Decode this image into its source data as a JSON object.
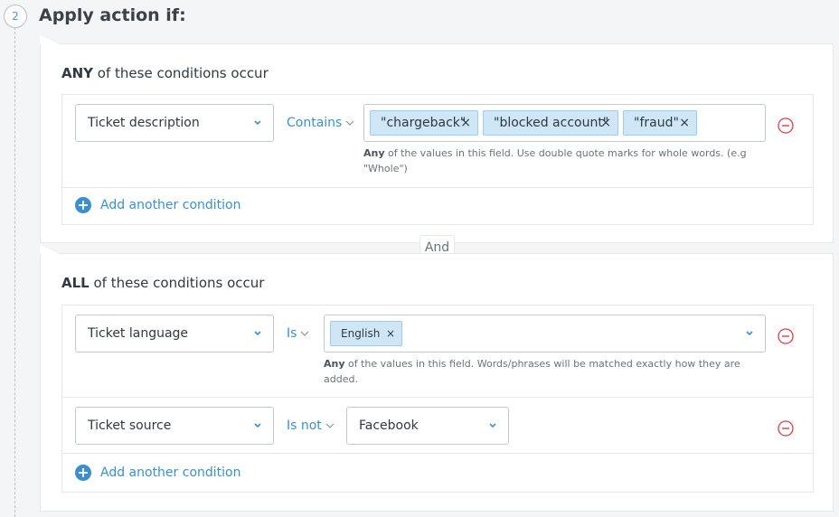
{
  "step": {
    "number": "2",
    "title": "Apply action if:"
  },
  "any_group": {
    "quantifier": "ANY",
    "heading_rest": " of these conditions occur",
    "conditions": [
      {
        "field": "Ticket description",
        "operator": "Contains",
        "tags": [
          "\"chargeback\"",
          "\"blocked account\"",
          "\"fraud\""
        ],
        "hint_bold": "Any",
        "hint_rest": " of the values in this field. Use double quote marks for whole words. (e.g \"Whole\")"
      }
    ],
    "add_label": "Add another condition"
  },
  "join_label": "And",
  "all_group": {
    "quantifier": "ALL",
    "heading_rest": " of these conditions occur",
    "conditions": [
      {
        "field": "Ticket language",
        "operator": "Is",
        "tags": [
          "English"
        ],
        "hint_bold": "Any",
        "hint_rest": " of the values in this field. Words/phrases will be matched exactly how they are added."
      },
      {
        "field": "Ticket source",
        "operator": "Is not",
        "value": "Facebook"
      }
    ],
    "add_label": "Add another condition"
  },
  "icons": {
    "chevron": "chevron-down-icon",
    "remove": "remove-circle-icon",
    "add": "plus-circle-icon",
    "tag_remove": "close-icon"
  },
  "colors": {
    "accent": "#3b8fd1",
    "tag_bg": "#cfe6f7",
    "remove": "#d93f4c",
    "border": "#c2c8cc"
  }
}
